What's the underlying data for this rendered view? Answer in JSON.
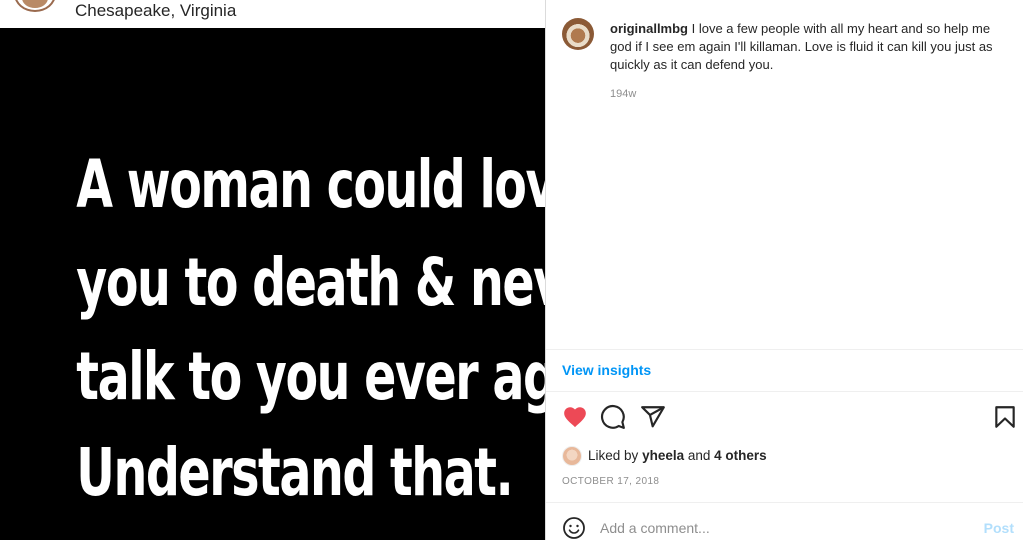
{
  "post": {
    "location": "Chesapeake, Virginia",
    "image_text": {
      "line1": "A woman could love",
      "line2": "you to death & never",
      "line3": "talk to you ever again.",
      "line4": "Understand that."
    }
  },
  "caption": {
    "username": "originallmbg",
    "text": "I love a few people with all my heart and so help me god if I see em again I'll killaman. Love is fluid it can kill you just as quickly as it can defend you.",
    "time_ago": "194w"
  },
  "insights_label": "View insights",
  "actions": {
    "icons": [
      "heart-icon",
      "comment-icon",
      "share-icon",
      "save-icon"
    ],
    "heart_color": "#ed4956"
  },
  "likes": {
    "prefix": "Liked by",
    "user": "yheela",
    "joiner": "and",
    "others": "4 others"
  },
  "date": "OCTOBER 17, 2018",
  "comment": {
    "placeholder": "Add a comment...",
    "post_label": "Post"
  },
  "colors": {
    "accent": "#0095f6",
    "post_disabled": "#b2dffc",
    "muted": "#8e8e8e"
  }
}
